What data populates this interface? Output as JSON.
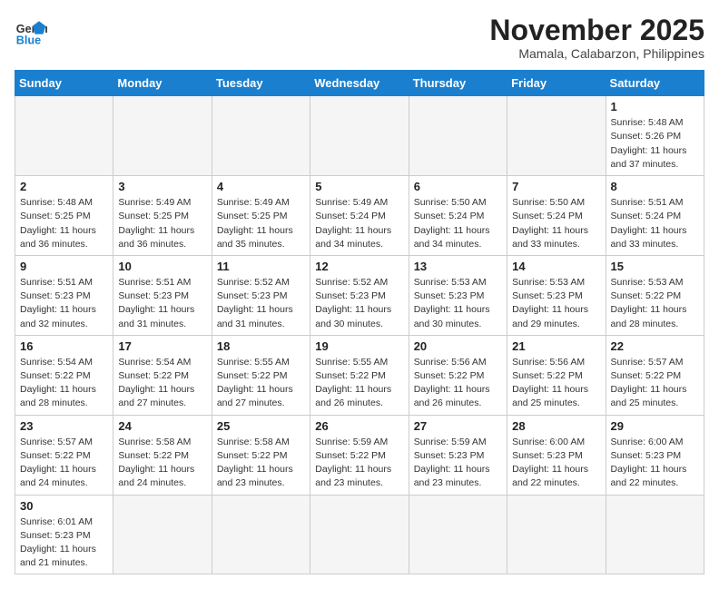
{
  "logo": {
    "general": "General",
    "blue": "Blue"
  },
  "header": {
    "month": "November 2025",
    "location": "Mamala, Calabarzon, Philippines"
  },
  "weekdays": [
    "Sunday",
    "Monday",
    "Tuesday",
    "Wednesday",
    "Thursday",
    "Friday",
    "Saturday"
  ],
  "weeks": [
    [
      {
        "day": "",
        "info": ""
      },
      {
        "day": "",
        "info": ""
      },
      {
        "day": "",
        "info": ""
      },
      {
        "day": "",
        "info": ""
      },
      {
        "day": "",
        "info": ""
      },
      {
        "day": "",
        "info": ""
      },
      {
        "day": "1",
        "info": "Sunrise: 5:48 AM\nSunset: 5:26 PM\nDaylight: 11 hours and 37 minutes."
      }
    ],
    [
      {
        "day": "2",
        "info": "Sunrise: 5:48 AM\nSunset: 5:25 PM\nDaylight: 11 hours and 36 minutes."
      },
      {
        "day": "3",
        "info": "Sunrise: 5:49 AM\nSunset: 5:25 PM\nDaylight: 11 hours and 36 minutes."
      },
      {
        "day": "4",
        "info": "Sunrise: 5:49 AM\nSunset: 5:25 PM\nDaylight: 11 hours and 35 minutes."
      },
      {
        "day": "5",
        "info": "Sunrise: 5:49 AM\nSunset: 5:24 PM\nDaylight: 11 hours and 34 minutes."
      },
      {
        "day": "6",
        "info": "Sunrise: 5:50 AM\nSunset: 5:24 PM\nDaylight: 11 hours and 34 minutes."
      },
      {
        "day": "7",
        "info": "Sunrise: 5:50 AM\nSunset: 5:24 PM\nDaylight: 11 hours and 33 minutes."
      },
      {
        "day": "8",
        "info": "Sunrise: 5:51 AM\nSunset: 5:24 PM\nDaylight: 11 hours and 33 minutes."
      }
    ],
    [
      {
        "day": "9",
        "info": "Sunrise: 5:51 AM\nSunset: 5:23 PM\nDaylight: 11 hours and 32 minutes."
      },
      {
        "day": "10",
        "info": "Sunrise: 5:51 AM\nSunset: 5:23 PM\nDaylight: 11 hours and 31 minutes."
      },
      {
        "day": "11",
        "info": "Sunrise: 5:52 AM\nSunset: 5:23 PM\nDaylight: 11 hours and 31 minutes."
      },
      {
        "day": "12",
        "info": "Sunrise: 5:52 AM\nSunset: 5:23 PM\nDaylight: 11 hours and 30 minutes."
      },
      {
        "day": "13",
        "info": "Sunrise: 5:53 AM\nSunset: 5:23 PM\nDaylight: 11 hours and 30 minutes."
      },
      {
        "day": "14",
        "info": "Sunrise: 5:53 AM\nSunset: 5:23 PM\nDaylight: 11 hours and 29 minutes."
      },
      {
        "day": "15",
        "info": "Sunrise: 5:53 AM\nSunset: 5:22 PM\nDaylight: 11 hours and 28 minutes."
      }
    ],
    [
      {
        "day": "16",
        "info": "Sunrise: 5:54 AM\nSunset: 5:22 PM\nDaylight: 11 hours and 28 minutes."
      },
      {
        "day": "17",
        "info": "Sunrise: 5:54 AM\nSunset: 5:22 PM\nDaylight: 11 hours and 27 minutes."
      },
      {
        "day": "18",
        "info": "Sunrise: 5:55 AM\nSunset: 5:22 PM\nDaylight: 11 hours and 27 minutes."
      },
      {
        "day": "19",
        "info": "Sunrise: 5:55 AM\nSunset: 5:22 PM\nDaylight: 11 hours and 26 minutes."
      },
      {
        "day": "20",
        "info": "Sunrise: 5:56 AM\nSunset: 5:22 PM\nDaylight: 11 hours and 26 minutes."
      },
      {
        "day": "21",
        "info": "Sunrise: 5:56 AM\nSunset: 5:22 PM\nDaylight: 11 hours and 25 minutes."
      },
      {
        "day": "22",
        "info": "Sunrise: 5:57 AM\nSunset: 5:22 PM\nDaylight: 11 hours and 25 minutes."
      }
    ],
    [
      {
        "day": "23",
        "info": "Sunrise: 5:57 AM\nSunset: 5:22 PM\nDaylight: 11 hours and 24 minutes."
      },
      {
        "day": "24",
        "info": "Sunrise: 5:58 AM\nSunset: 5:22 PM\nDaylight: 11 hours and 24 minutes."
      },
      {
        "day": "25",
        "info": "Sunrise: 5:58 AM\nSunset: 5:22 PM\nDaylight: 11 hours and 23 minutes."
      },
      {
        "day": "26",
        "info": "Sunrise: 5:59 AM\nSunset: 5:22 PM\nDaylight: 11 hours and 23 minutes."
      },
      {
        "day": "27",
        "info": "Sunrise: 5:59 AM\nSunset: 5:23 PM\nDaylight: 11 hours and 23 minutes."
      },
      {
        "day": "28",
        "info": "Sunrise: 6:00 AM\nSunset: 5:23 PM\nDaylight: 11 hours and 22 minutes."
      },
      {
        "day": "29",
        "info": "Sunrise: 6:00 AM\nSunset: 5:23 PM\nDaylight: 11 hours and 22 minutes."
      }
    ],
    [
      {
        "day": "30",
        "info": "Sunrise: 6:01 AM\nSunset: 5:23 PM\nDaylight: 11 hours and 21 minutes."
      },
      {
        "day": "",
        "info": ""
      },
      {
        "day": "",
        "info": ""
      },
      {
        "day": "",
        "info": ""
      },
      {
        "day": "",
        "info": ""
      },
      {
        "day": "",
        "info": ""
      },
      {
        "day": "",
        "info": ""
      }
    ]
  ]
}
